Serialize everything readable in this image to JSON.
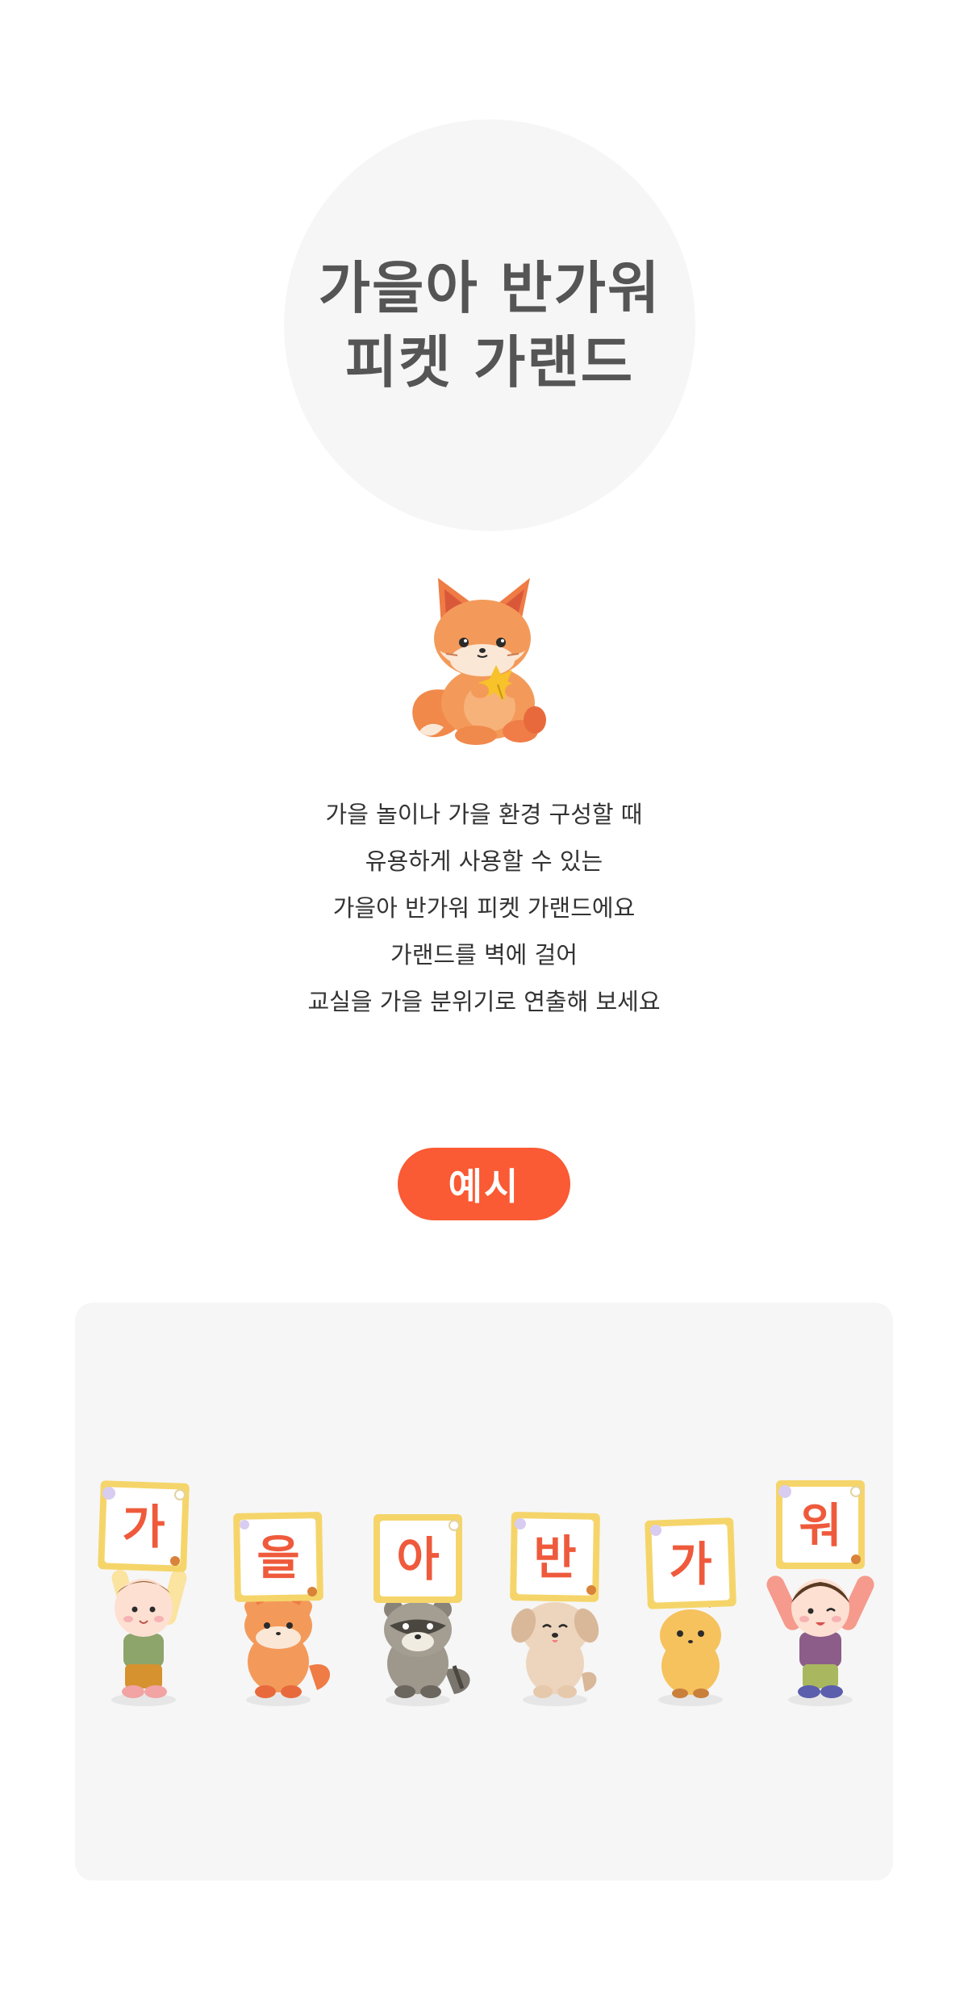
{
  "hero": {
    "title_line_1": "가을아 반가워",
    "title_line_2": "피켓 가랜드"
  },
  "mascot": {
    "icon": "fox-holding-leaf-icon"
  },
  "description": {
    "lines": [
      "가을 놀이나 가을 환경 구성할 때",
      "유용하게 사용할 수 있는",
      "가을아 반가워 피켓 가랜드에요",
      "가랜드를 벽에 걸어",
      "교실을 가을 분위기로 연출해 보세요"
    ]
  },
  "example": {
    "badge_label": "예시",
    "garland": [
      {
        "character": "child-boy-icon",
        "letter": "가"
      },
      {
        "character": "fox-icon",
        "letter": "을"
      },
      {
        "character": "raccoon-icon",
        "letter": "아"
      },
      {
        "character": "puppy-icon",
        "letter": "반"
      },
      {
        "character": "chipmunk-icon",
        "letter": "가"
      },
      {
        "character": "child-girl-icon",
        "letter": "워"
      }
    ]
  },
  "colors": {
    "accent": "#fa5a34",
    "title_gray": "#555555",
    "panel_bg": "#f6f6f6",
    "letter_red": "#ef5a3c",
    "sign_frame": "#f5d56a"
  }
}
